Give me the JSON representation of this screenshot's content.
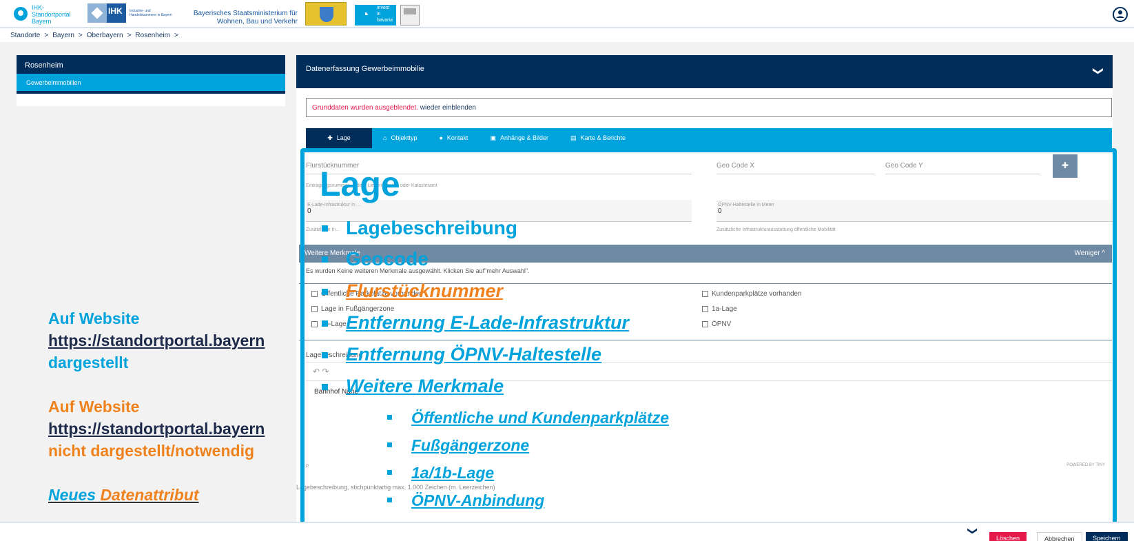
{
  "header": {
    "portal_name": "IHK-Standortportal Bayern",
    "ihk": "IHK",
    "ihk_sub": "Industrie- und Handelskammern in Bayern",
    "ministry_line1": "Bayerisches Staatsministerium für",
    "ministry_line2": "Wohnen, Bau und Verkehr",
    "invest_line1": "invest",
    "invest_line2": "in",
    "invest_line3": "bavaria"
  },
  "breadcrumb": {
    "items": [
      "Standorte",
      "Bayern",
      "Oberbayern",
      "Rosenheim"
    ],
    "separator": ">"
  },
  "sidebar": {
    "title": "Rosenheim",
    "item": "Gewerbeimmobilien"
  },
  "main": {
    "title": "Datenerfassung Gewerbeimmobilie",
    "notice_red": "Grunddaten wurden ausgeblendet.",
    "notice_link": "wieder einblenden",
    "tabs": [
      "Lage",
      "Objekttyp",
      "Kontakt",
      "Anhänge & Bilder",
      "Karte & Berichte"
    ],
    "fields": {
      "flurstueck": "Flurstücknummer",
      "geo_x": "Geo Code X",
      "geo_y": "Geo Code Y",
      "flur_hint": "Eintragungsnummer … dem Liegenschafts- oder Katasteramt",
      "elade_label": "E-Lade-Infrastruktur in …",
      "elade_value": "0",
      "oepnv_label": "ÖPNV-Haltestelle in Meter",
      "oepnv_value": "0",
      "elade_hint": "Zusätzliche In…",
      "oepnv_hint": "Zusätzliche Infrastrukturausstattung öffentliche Mobilität"
    },
    "weitere": {
      "title": "Weitere Merkmale",
      "toggle": "Weniger ^",
      "info": "Es wurden Keine weiteren Merkmale ausgewählt. Klicken Sie auf\"mehr Auswahl\"."
    },
    "checkboxes": [
      "Öffentliche Parkplätze vorhanden",
      "Kundenparkplätze vorhanden",
      "Lage in Fußgängerzone",
      "1a-Lage",
      "1b-Lage",
      "ÖPNV"
    ],
    "lage_label": "Lagebeschreibung",
    "editor_text": "Bahnhof Nähe",
    "editor_hint": "Lagebeschreibung, stichpunktartig max. 1.000 Zeichen (m. Leerzeichen)",
    "powered": "POWERED BY TINY",
    "editor_p": "p"
  },
  "overlay": {
    "heading": "Lage",
    "items": [
      "Lagebeschreibung",
      "Geocode"
    ],
    "orange_item": "Flurstücknummer",
    "new_items": [
      "Entfernung E-Lade-Infrastruktur",
      "Entfernung ÖPNV-Haltestelle",
      "Weitere Merkmale"
    ],
    "sub_items": [
      "Öffentliche und Kundenparkplätze",
      "Fußgängerzone",
      "1a/1b-Lage",
      "ÖPNV-Anbindung"
    ]
  },
  "legend": {
    "blue_line1": "Auf Website",
    "blue_link": "https://standortportal.bayern",
    "blue_line3": "dargestellt",
    "orange_line1": "Auf Website",
    "orange_link": "https://standortportal.bayern",
    "orange_line3": "nicht dargestellt/notwendig",
    "new_prefix": "Neues ",
    "new_word": "Datenattribut"
  },
  "footer": {
    "delete": "Löschen",
    "cancel": "Abbrechen",
    "save": "Speichern"
  },
  "colors": {
    "navy": "#002d5a",
    "cyan": "#00a3dc",
    "orange": "#f0821e",
    "red": "#e6194b"
  }
}
